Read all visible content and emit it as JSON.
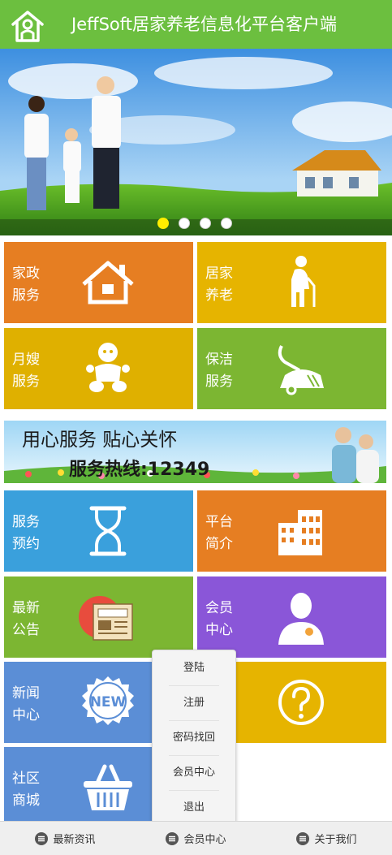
{
  "header": {
    "title": "JeffSoft居家养老信息化平台客户端",
    "logo_icon": "home-user-icon"
  },
  "banner": {
    "slides": 4,
    "active_slide": 1
  },
  "tiles_top": [
    {
      "line1": "家政",
      "line2": "服务",
      "icon": "house-icon",
      "color": "#e67e22"
    },
    {
      "line1": "居家",
      "line2": "养老",
      "icon": "elderly-person-icon",
      "color": "#e6b400"
    },
    {
      "line1": "月嫂",
      "line2": "服务",
      "icon": "baby-icon",
      "color": "#dfb000"
    },
    {
      "line1": "保洁",
      "line2": "服务",
      "icon": "vacuum-cleaner-icon",
      "color": "#7cb632"
    }
  ],
  "promo": {
    "line1": "用心服务  贴心关怀",
    "line2": "服务热线:12349"
  },
  "tiles_bottom": [
    {
      "line1": "服务",
      "line2": "预约",
      "icon": "hourglass-icon",
      "color": "#3aa0dc"
    },
    {
      "line1": "平台",
      "line2": "简介",
      "icon": "building-icon",
      "color": "#e67e22"
    },
    {
      "line1": "最新",
      "line2": "公告",
      "icon": "announcement-icon",
      "color": "#7cb632"
    },
    {
      "line1": "会员",
      "line2": "中心",
      "icon": "member-icon",
      "color": "#8a56d8"
    },
    {
      "line1": "新闻",
      "line2": "中心",
      "icon": "new-badge-icon",
      "color": "#5b8ed6"
    },
    {
      "line1": "",
      "line2": "",
      "icon": "question-icon",
      "color": "#e6b400"
    },
    {
      "line1": "社区",
      "line2": "商城",
      "icon": "shopping-basket-icon",
      "color": "#5b8ed6"
    }
  ],
  "popup_menu": {
    "items": [
      "登陆",
      "注册",
      "密码找回",
      "会员中心",
      "退出"
    ]
  },
  "footer": {
    "items": [
      {
        "label": "最新资讯",
        "icon": "menu-icon"
      },
      {
        "label": "会员中心",
        "icon": "menu-icon"
      },
      {
        "label": "关于我们",
        "icon": "menu-icon"
      }
    ]
  }
}
